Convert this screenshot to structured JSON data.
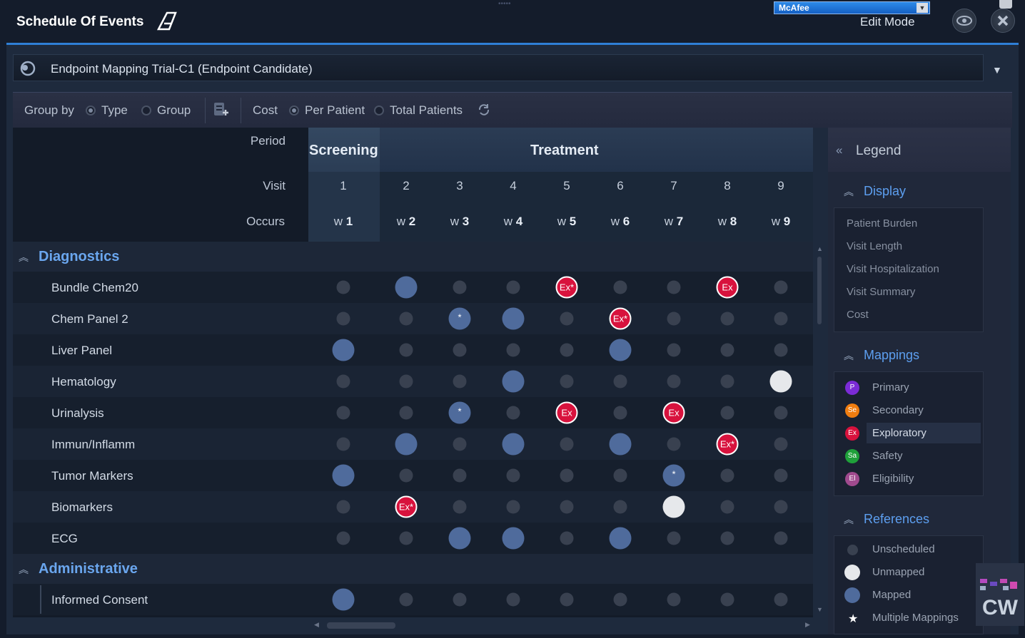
{
  "app": {
    "title": "Schedule Of Events",
    "mcafee": "McAfee",
    "edit_mode": "Edit Mode"
  },
  "trial": {
    "title": "Endpoint Mapping Trial-C1  (Endpoint Candidate)"
  },
  "toolbar": {
    "group_by": "Group by",
    "type": "Type",
    "group": "Group",
    "cost": "Cost",
    "per_patient": "Per Patient",
    "total_patients": "Total Patients"
  },
  "header": {
    "period_label": "Period",
    "visit_label": "Visit",
    "occurs_label": "Occurs",
    "screening": "Screening",
    "treatment": "Treatment",
    "visits": [
      "1",
      "2",
      "3",
      "4",
      "5",
      "6",
      "7",
      "8",
      "9"
    ],
    "occurs_prefix": "w",
    "occurs": [
      "1",
      "2",
      "3",
      "4",
      "5",
      "6",
      "7",
      "8",
      "9"
    ]
  },
  "sections": [
    {
      "title": "Diagnostics",
      "rows": [
        {
          "label": "Bundle Chem20",
          "cells": [
            "u",
            "m",
            "u",
            "u",
            "ex*",
            "u",
            "u",
            "ex",
            "u"
          ]
        },
        {
          "label": "Chem Panel 2",
          "cells": [
            "u",
            "u",
            "m*",
            "m",
            "u",
            "ex*",
            "u",
            "u",
            "u"
          ]
        },
        {
          "label": "Liver Panel",
          "cells": [
            "m",
            "u",
            "u",
            "u",
            "u",
            "m",
            "u",
            "u",
            "u"
          ]
        },
        {
          "label": "Hematology",
          "cells": [
            "u",
            "u",
            "u",
            "m",
            "u",
            "u",
            "u",
            "u",
            "um"
          ]
        },
        {
          "label": "Urinalysis",
          "cells": [
            "u",
            "u",
            "m*",
            "u",
            "ex",
            "u",
            "ex",
            "u",
            "u"
          ]
        },
        {
          "label": "Immun/Inflamm",
          "cells": [
            "u",
            "m",
            "u",
            "m",
            "u",
            "m",
            "u",
            "ex*",
            "u"
          ]
        },
        {
          "label": "Tumor Markers",
          "cells": [
            "m",
            "u",
            "u",
            "u",
            "u",
            "u",
            "m*",
            "u",
            "u"
          ]
        },
        {
          "label": "Biomarkers",
          "cells": [
            "u",
            "ex*",
            "u",
            "u",
            "u",
            "u",
            "um",
            "u",
            "u"
          ]
        },
        {
          "label": "ECG",
          "cells": [
            "u",
            "u",
            "m",
            "m",
            "u",
            "m",
            "u",
            "u",
            "u"
          ]
        }
      ]
    },
    {
      "title": "Administrative",
      "rows": [
        {
          "label": "Informed Consent",
          "cells": [
            "m",
            "u",
            "u",
            "u",
            "u",
            "u",
            "u",
            "u",
            "u"
          ]
        }
      ]
    }
  ],
  "badges": {
    "ex": "Ex",
    "ex_star": "Ex*"
  },
  "legend": {
    "title": "Legend",
    "display_title": "Display",
    "display_items": [
      "Patient Burden",
      "Visit Length",
      "Visit Hospitalization",
      "Visit Summary",
      "Cost"
    ],
    "mappings_title": "Mappings",
    "mappings": [
      {
        "abbr": "P",
        "label": "Primary",
        "color": "#7b2bd6"
      },
      {
        "abbr": "Se",
        "label": "Secondary",
        "color": "#f07d10"
      },
      {
        "abbr": "Ex",
        "label": "Exploratory",
        "color": "#d8123d"
      },
      {
        "abbr": "Sa",
        "label": "Safety",
        "color": "#1fa03a"
      },
      {
        "abbr": "El",
        "label": "Eligibility",
        "color": "#a04a8e"
      }
    ],
    "references_title": "References",
    "references": [
      "Unscheduled",
      "Unmapped",
      "Mapped",
      "Multiple Mappings"
    ]
  },
  "logo_text": "CW"
}
